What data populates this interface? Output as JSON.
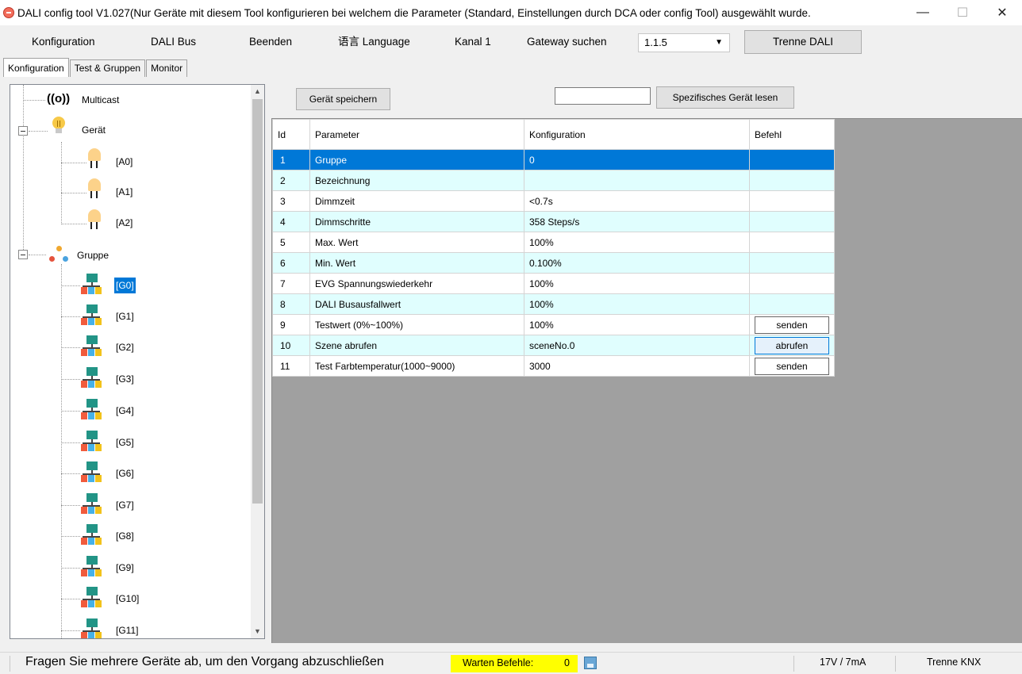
{
  "window": {
    "title": "DALI config tool V1.027(Nur Geräte mit diesem Tool konfigurieren bei welchem die Parameter (Standard, Einstellungen durch DCA oder config Tool) ausgewählt wurde.",
    "minimize": "—",
    "maximize": "☐",
    "close": "✕"
  },
  "menu": {
    "items": [
      "Konfiguration",
      "DALI Bus",
      "Beenden",
      "语言 Language",
      "Kanal 1",
      "Gateway suchen"
    ],
    "gateway_select": {
      "value": "1.1.5"
    },
    "trenne_dali": "Trenne DALI"
  },
  "tabs": [
    "Konfiguration",
    "Test & Gruppen",
    "Monitor"
  ],
  "tree": {
    "multicast": "Multicast",
    "geraet": "Gerät",
    "devices": [
      "[A0]",
      "[A1]",
      "[A2]"
    ],
    "gruppe": "Gruppe",
    "groups": [
      "[G0]",
      "[G1]",
      "[G2]",
      "[G3]",
      "[G4]",
      "[G5]",
      "[G6]",
      "[G7]",
      "[G8]",
      "[G9]",
      "[G10]",
      "[G11]"
    ],
    "selected": "[G0]"
  },
  "toolbar": {
    "save_label": "Gerät speichern",
    "device_input_value": "",
    "read_label": "Spezifisches Gerät lesen"
  },
  "table": {
    "columns": [
      "Id",
      "Parameter",
      "Konfiguration",
      "Befehl"
    ],
    "rows": [
      {
        "id": "1",
        "parameter": "Gruppe",
        "konfiguration": "0",
        "befehl": ""
      },
      {
        "id": "2",
        "parameter": "Bezeichnung",
        "konfiguration": "",
        "befehl": ""
      },
      {
        "id": "3",
        "parameter": "Dimmzeit",
        "konfiguration": "<0.7s",
        "befehl": ""
      },
      {
        "id": "4",
        "parameter": "Dimmschritte",
        "konfiguration": "358 Steps/s",
        "befehl": ""
      },
      {
        "id": "5",
        "parameter": "Max. Wert",
        "konfiguration": "100%",
        "befehl": ""
      },
      {
        "id": "6",
        "parameter": "Min. Wert",
        "konfiguration": "0.100%",
        "befehl": ""
      },
      {
        "id": "7",
        "parameter": "EVG Spannungswiederkehr",
        "konfiguration": "100%",
        "befehl": ""
      },
      {
        "id": "8",
        "parameter": "DALI Busausfallwert",
        "konfiguration": "100%",
        "befehl": ""
      },
      {
        "id": "9",
        "parameter": "Testwert (0%~100%)",
        "konfiguration": "100%",
        "befehl": "senden"
      },
      {
        "id": "10",
        "parameter": "Szene abrufen",
        "konfiguration": "sceneNo.0",
        "befehl": "abrufen"
      },
      {
        "id": "11",
        "parameter": "Test Farbtemperatur(1000~9000)",
        "konfiguration": "3000",
        "befehl": "senden"
      }
    ]
  },
  "status": {
    "message": "Fragen Sie mehrere Geräte ab, um den Vorgang abzuschließen",
    "warten_label": "Warten Befehle:",
    "warten_count": "0",
    "power": "17V / 7mA",
    "trenne_knx": "Trenne KNX"
  },
  "colors": {
    "selection": "#0078d7",
    "row_alt": "#e0fefe",
    "warten_highlight": "#ffff00",
    "group_icon_top": "#229486"
  }
}
